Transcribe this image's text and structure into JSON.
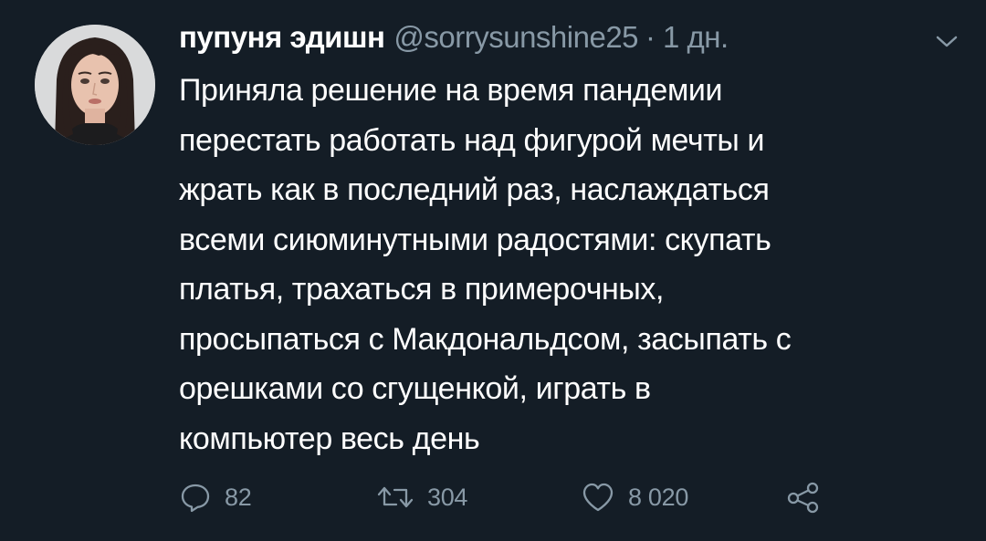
{
  "tweet": {
    "display_name": "пупуня эдишн",
    "handle": "@sorrysunshine25",
    "separator": "·",
    "time": "1 дн.",
    "avatar_icon": "user-avatar",
    "menu_icon": "chevron-down-icon",
    "text_lines": [
      "Приняла решение на время пандемии",
      "перестать работать над фигурой мечты и",
      "жрать как в последний раз, наслаждаться",
      "всеми сиюминутными радостями: скупать",
      "платья, трахаться в примерочных,",
      "просыпаться с Макдональдсом, засыпать с",
      "орешками со сгущенкой, играть в",
      "компьютер весь день"
    ],
    "actions": {
      "reply_count": "82",
      "retweet_count": "304",
      "like_count": "8 020"
    }
  },
  "colors": {
    "background": "#141d26",
    "text_primary": "#ffffff",
    "text_secondary": "#8899a6"
  }
}
